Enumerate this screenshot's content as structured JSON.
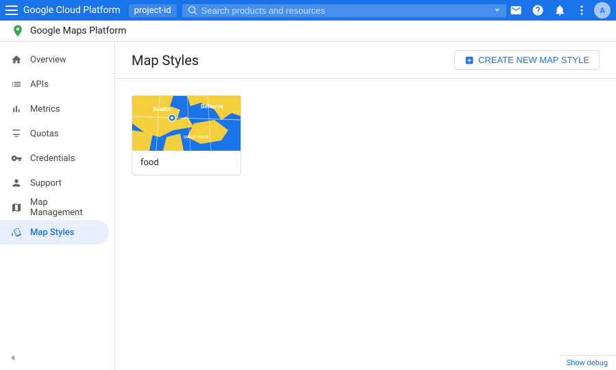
{
  "topBar": {
    "menuIcon": "☰",
    "title": "Google Cloud Platform",
    "project": "project-id",
    "searchPlaceholder": "Search products and resources",
    "dropdownIcon": "▾",
    "icons": {
      "email": "✉",
      "help": "?",
      "notifications": "🔔",
      "more": "⋮"
    },
    "avatarText": "A"
  },
  "secondBar": {
    "productName": "Google Maps Platform"
  },
  "sidebar": {
    "items": [
      {
        "id": "overview",
        "label": "Overview",
        "icon": "home"
      },
      {
        "id": "apis",
        "label": "APIs",
        "icon": "list"
      },
      {
        "id": "metrics",
        "label": "Metrics",
        "icon": "bar_chart"
      },
      {
        "id": "quotas",
        "label": "Quotas",
        "icon": "monitor"
      },
      {
        "id": "credentials",
        "label": "Credentials",
        "icon": "vpn_key"
      },
      {
        "id": "support",
        "label": "Support",
        "icon": "person"
      },
      {
        "id": "map-management",
        "label": "Map Management",
        "icon": "map"
      },
      {
        "id": "map-styles",
        "label": "Map Styles",
        "icon": "style",
        "active": true
      }
    ],
    "collapseIcon": "«"
  },
  "contentHeader": {
    "title": "Map Styles",
    "createButton": {
      "icon": "+",
      "label": "CREATE NEW MAP STYLE"
    }
  },
  "mapCards": [
    {
      "id": "food-style",
      "label": "food",
      "hasImage": true
    }
  ],
  "debugBar": {
    "label": "Show debug"
  }
}
